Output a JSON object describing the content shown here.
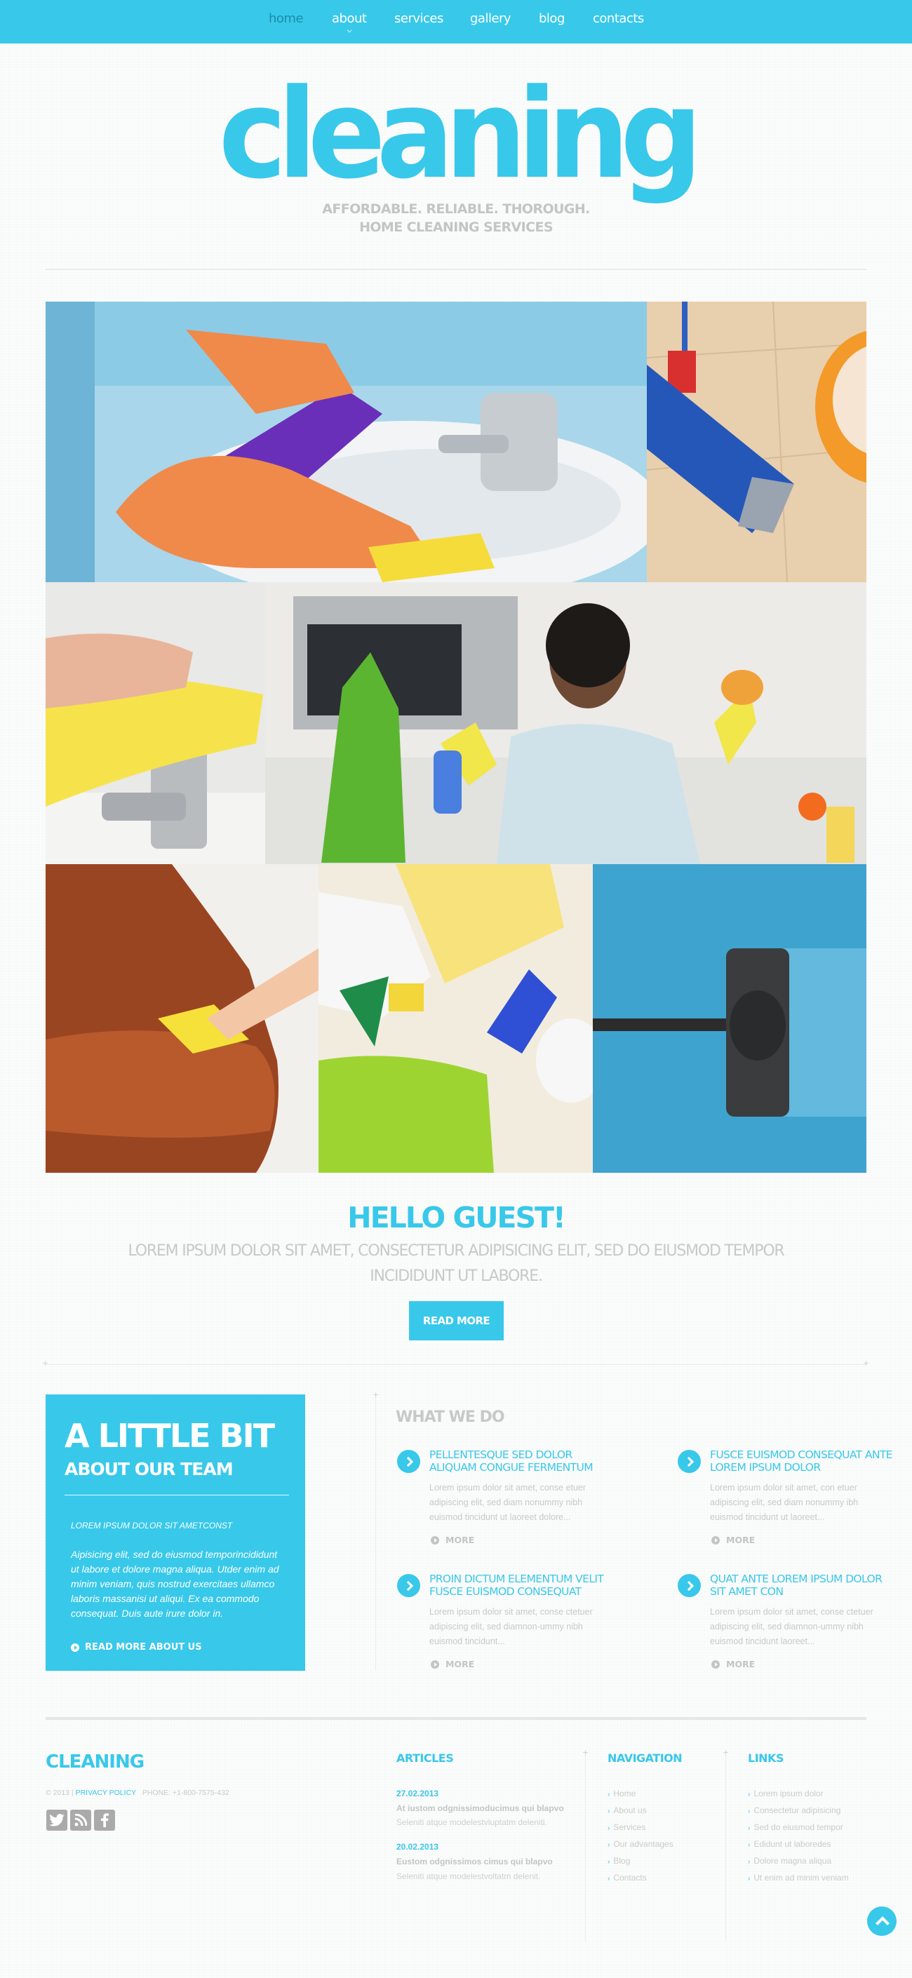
{
  "nav": {
    "items": [
      {
        "label": "home",
        "active": true
      },
      {
        "label": "about",
        "has_submenu": true
      },
      {
        "label": "services"
      },
      {
        "label": "gallery"
      },
      {
        "label": "blog"
      },
      {
        "label": "contacts"
      }
    ]
  },
  "header": {
    "logo": "cleaning",
    "tagline_line1": "AFFORDABLE. RELIABLE. THOROUGH.",
    "tagline_line2": "HOME CLEANING SERVICES"
  },
  "gallery": {
    "tiles": [
      {
        "name": "gloved-hands-cleaning-sink"
      },
      {
        "name": "mop-and-bucket-on-tiles"
      },
      {
        "name": "hand-wiping-faucet"
      },
      {
        "name": "smiling-woman-in-kitchen"
      },
      {
        "name": "wiping-leather-sofa"
      },
      {
        "name": "sponges-and-spray-bottles"
      },
      {
        "name": "vacuum-on-blue-carpet"
      }
    ]
  },
  "hello": {
    "title": "HELLO GUEST!",
    "text": "LOREM IPSUM DOLOR SIT AMET, CONSECTETUR ADIPISICING ELIT, SED DO EIUSMOD TEMPOR INCIDIDUNT UT LABORE.",
    "button": "READ MORE"
  },
  "team": {
    "heading1": "A LITTLE BIT",
    "heading2": "ABOUT OUR TEAM",
    "subheading": "LOREM IPSUM DOLOR SIT AMETCONST",
    "body": "Aipisicing elit, sed do eiusmod temporincididunt ut labore et dolore magna aliqua. Utder enim ad minim veniam, quis nostrud exercitaes ullamco laboris massanisi ut aliqui. Ex ea commodo consequat. Duis aute irure dolor in.",
    "link": "READ MORE ABOUT US"
  },
  "what_we_do": {
    "title": "WHAT WE DO",
    "more_label": "MORE",
    "items": [
      {
        "title": "PELLENTESQUE SED DOLOR ALIQUAM CONGUE FERMENTUM",
        "text": "Lorem ipsum dolor sit amet, conse etuer adipiscing elit, sed diam nonummy nibh euismod tincidunt ut laoreet dolore..."
      },
      {
        "title": "FUSCE EUISMOD CONSEQUAT ANTE LOREM IPSUM DOLOR",
        "text": "Lorem ipsum dolor sit amet, con etuer adipiscing elit, sed diam nonummy ibh euismod tincidunt ut laoreet..."
      },
      {
        "title": "PROIN DICTUM ELEMENTUM VELIT FUSCE EUISMOD CONSEQUAT",
        "text": "Lorem ipsum dolor sit amet, conse ctetuer adipiscing elit, sed diamnon-ummy nibh euismod tincidunt..."
      },
      {
        "title": "QUAT ANTE LOREM IPSUM DOLOR SIT AMET CON",
        "text": "Lorem ipsum dolor sit amet, conse ctetuer adipiscing elit, sed diamnon-ummy nibh euismod tincidunt laoreet..."
      }
    ]
  },
  "footer": {
    "logo": "CLEANING",
    "copyright": "© 2013 |",
    "privacy": "PRIVACY POLICY",
    "phone": "PHONE: +1-800-7575-432",
    "social": [
      {
        "icon": "twitter-icon"
      },
      {
        "icon": "rss-icon"
      },
      {
        "icon": "facebook-icon"
      }
    ],
    "articles": {
      "title": "ARTICLES",
      "items": [
        {
          "date": "27.02.2013",
          "title": "At iustom odgnissimoducimus qui blapvo",
          "text": "Seleniti atque modelestvluptatm deleniti."
        },
        {
          "date": "20.02.2013",
          "title": "Eustom odgnissimos cimus qui blapvo",
          "text": "Seleniti atque modelestvoltatm delenit."
        }
      ]
    },
    "navigation": {
      "title": "NAVIGATION",
      "items": [
        "Home",
        "About us",
        "Services",
        "Our advantages",
        "Blog",
        "Contacts"
      ]
    },
    "links": {
      "title": "LINKS",
      "items": [
        "Lorem ipsum dolor",
        "Consectetur adipisicing",
        "Sed do eiusmod tempor",
        "Edidunt ut laboredes",
        "Dolore magna aliqua",
        "Ut enim ad minim veniam"
      ]
    }
  },
  "colors": {
    "accent": "#38c8ea",
    "nav_active": "#1a8ea8",
    "muted_text": "#c8c8c8"
  }
}
